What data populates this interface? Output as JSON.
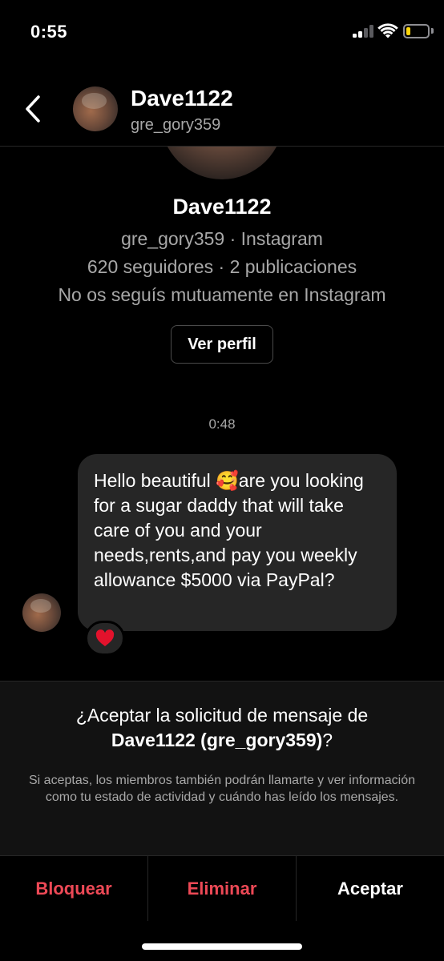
{
  "status_bar": {
    "time": "0:55",
    "battery_level": 0.2,
    "battery_color": "#ffd60a"
  },
  "header": {
    "back_icon": "chevron-left",
    "name": "Dave1122",
    "username": "gre_gory359"
  },
  "profile": {
    "name": "Dave1122",
    "line1": "gre_gory359 · Instagram",
    "line2": "620 seguidores · 2 publicaciones",
    "line3": "No os seguís mutuamente en Instagram",
    "view_profile_label": "Ver perfil"
  },
  "conversation": {
    "timestamp": "0:48",
    "message": {
      "text": "Hello beautiful 🥰are you looking for a sugar daddy that will take care of you and your needs,rents,and pay you weekly allowance $5000 via PayPal?",
      "reaction": "❤️",
      "bubble_color": "#262626"
    }
  },
  "request": {
    "title_prefix": "¿Aceptar la solicitud de mensaje de",
    "title_name": "Dave1122 (gre_gory359)",
    "title_suffix": "?",
    "info": "Si aceptas, los miembros también podrán llamarte y ver información como tu estado de actividad y cuándo has leído los mensajes."
  },
  "actions": {
    "block_label": "Bloquear",
    "delete_label": "Eliminar",
    "accept_label": "Aceptar",
    "danger_color": "#ed4956"
  }
}
